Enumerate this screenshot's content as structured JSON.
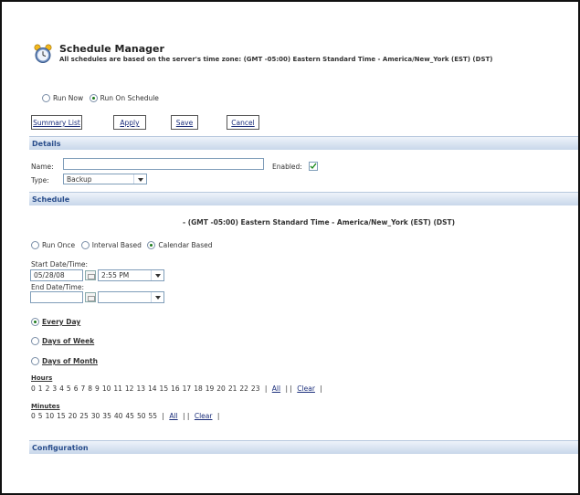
{
  "header": {
    "title": "Schedule Manager",
    "subtitle": "All schedules are based on the server's time zone: (GMT -05:00) Eastern Standard Time - America/New_York (EST) (DST)"
  },
  "run_mode": {
    "options": [
      "Run Now",
      "Run On Schedule"
    ],
    "selected": "Run On Schedule"
  },
  "toolbar": {
    "summary_label": "Summary List",
    "apply_label": "Apply",
    "save_label": "Save",
    "cancel_label": "Cancel"
  },
  "details": {
    "section_title": "Details",
    "name_label": "Name:",
    "name_value": "",
    "enabled_label": "Enabled:",
    "enabled_checked": true,
    "type_label": "Type:",
    "type_value": "Backup"
  },
  "schedule": {
    "section_title": "Schedule",
    "timezone": "- (GMT -05:00) Eastern Standard Time - America/New_York (EST) (DST)",
    "mode_options": [
      "Run Once",
      "Interval Based",
      "Calendar Based"
    ],
    "mode_selected": "Calendar Based",
    "start_label": "Start Date/Time:",
    "start_date": "05/28/08",
    "start_time": "2:55 PM",
    "end_label": "End Date/Time:",
    "end_date": "",
    "end_time": "",
    "frequency": {
      "every_day": "Every Day",
      "days_of_week": "Days of Week",
      "days_of_month": "Days of Month",
      "selected": "Every Day"
    },
    "hours_label": "Hours",
    "hours": [
      "0",
      "1",
      "2",
      "3",
      "4",
      "5",
      "6",
      "7",
      "8",
      "9",
      "10",
      "11",
      "12",
      "13",
      "14",
      "15",
      "16",
      "17",
      "18",
      "19",
      "20",
      "21",
      "22",
      "23"
    ],
    "minutes_label": "Minutes",
    "minutes": [
      "0",
      "5",
      "10",
      "15",
      "20",
      "25",
      "30",
      "35",
      "40",
      "45",
      "50",
      "55"
    ],
    "all_label": "All",
    "clear_label": "Clear"
  },
  "configuration": {
    "section_title": "Configuration"
  },
  "colors": {
    "section_bar": "#c8d7ea",
    "section_text": "#2a4e8c",
    "link": "#1a2d7a",
    "radio_selected": "#1c7a1c"
  },
  "icons": {
    "logo": "alarm-clock-icon",
    "calendar": "calendar-icon",
    "dropdown": "chevron-down-icon",
    "checkbox": "checkmark-icon"
  }
}
